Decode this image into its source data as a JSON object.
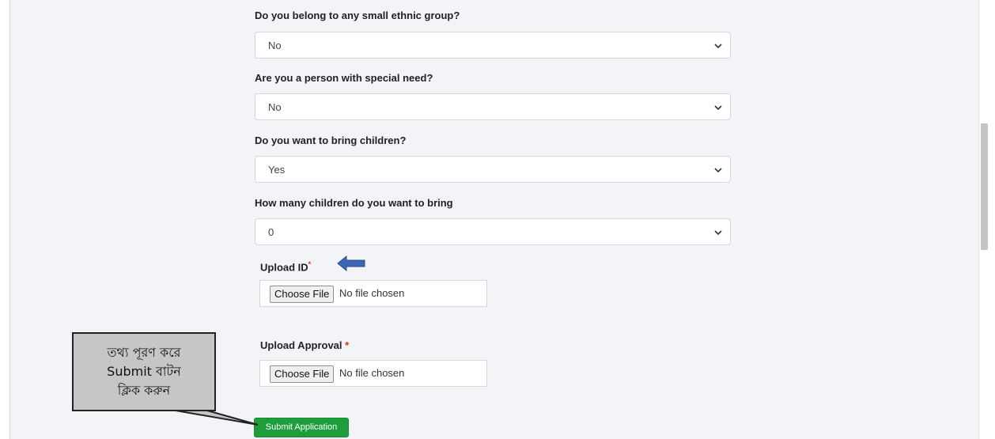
{
  "form": {
    "q_ethnic": {
      "label": "Do you belong to any small ethnic group?",
      "value": "No"
    },
    "q_special_need": {
      "label": "Are you a person with special need?",
      "value": "No"
    },
    "q_bring_children": {
      "label": "Do you want to bring children?",
      "value": "Yes"
    },
    "q_children_count": {
      "label": "How many children do you want to bring",
      "value": "0"
    },
    "upload_id": {
      "label": "Upload ID",
      "required_mark": "*",
      "button": "Choose File",
      "status": "No file chosen"
    },
    "upload_approval": {
      "label": "Upload Approval",
      "required_mark": "*",
      "button": "Choose File",
      "status": "No file chosen"
    },
    "submit_label": "Submit Application"
  },
  "annotation": {
    "callout_lines": [
      "তথ্য পূরণ করে",
      "Submit বাটন",
      "ক্লিক করুন"
    ],
    "arrow_color": "#3d67b3"
  },
  "colors": {
    "submit_bg": "#1e9e3a",
    "required": "#d93025",
    "page_bg": "#f2f4f7"
  },
  "icons": {
    "select_chevron": "chevron-down-icon",
    "annotation_arrow": "left-arrow-icon"
  }
}
